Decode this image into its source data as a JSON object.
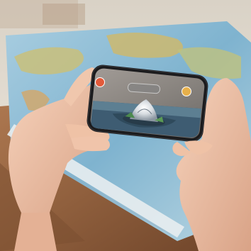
{
  "scene": {
    "description_icon": "ar-phone-over-world-map",
    "colors": {
      "sky_bg": "#e9e4dc",
      "map_ocean": "#7fb3cf",
      "map_land": "#c9c07a",
      "wood": "#9a6a45",
      "skin": "#efc3a8",
      "phone_body": "#1b1b1d",
      "ar_back_button": "#e25a3a",
      "ar_coin_button": "#e7b04a"
    }
  }
}
